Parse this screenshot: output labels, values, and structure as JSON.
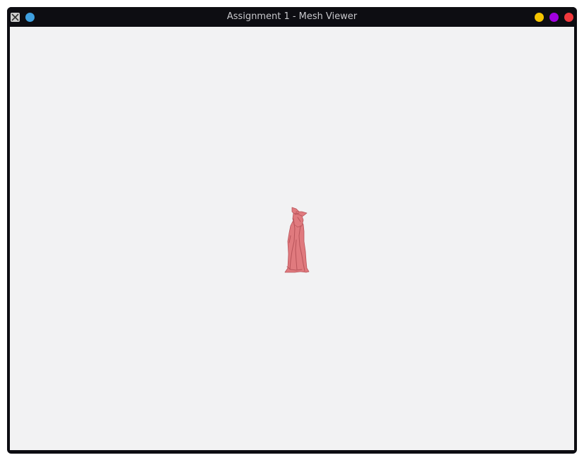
{
  "window": {
    "title": "Assignment 1 - Mesh Viewer",
    "app_icon": "x-window-icon",
    "controls": {
      "pin_color": "#3fa0e0",
      "minimize_color": "#f5c400",
      "maximize_color": "#a100e0",
      "close_color": "#f0383c"
    }
  },
  "viewport": {
    "background": "#f2f2f3",
    "mesh": {
      "name": "bunny-mesh",
      "color": "#e07a7e",
      "shadow_color": "#b8545a"
    }
  }
}
